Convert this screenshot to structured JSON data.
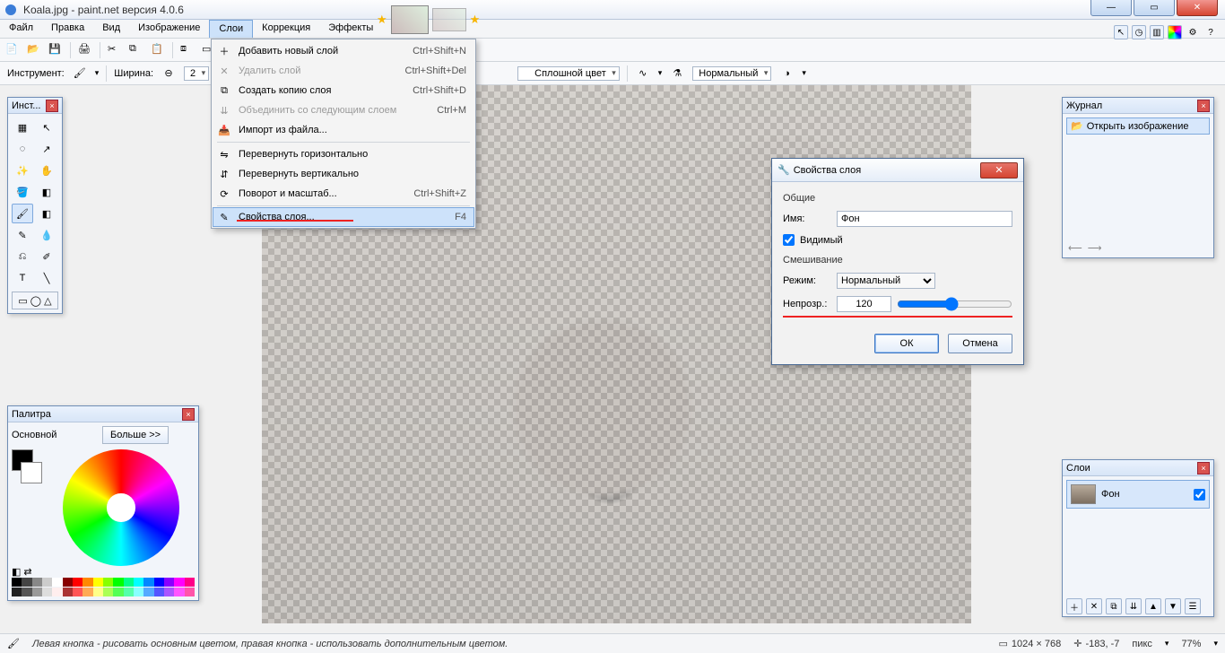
{
  "title": "Koala.jpg - paint.net версия 4.0.6",
  "menubar": [
    "Файл",
    "Правка",
    "Вид",
    "Изображение",
    "Слои",
    "Коррекция",
    "Эффекты"
  ],
  "menubar_active_index": 4,
  "layers_menu": {
    "items": [
      {
        "label": "Добавить новый слой",
        "sc": "Ctrl+Shift+N",
        "disabled": false
      },
      {
        "label": "Удалить слой",
        "sc": "Ctrl+Shift+Del",
        "disabled": true
      },
      {
        "label": "Создать копию слоя",
        "sc": "Ctrl+Shift+D",
        "disabled": false
      },
      {
        "label": "Объединить со следующим слоем",
        "sc": "Ctrl+M",
        "disabled": true
      },
      {
        "label": "Импорт из файла...",
        "sc": "",
        "disabled": false
      },
      {
        "sep": true
      },
      {
        "label": "Перевернуть горизонтально",
        "sc": "",
        "disabled": false
      },
      {
        "label": "Перевернуть вертикально",
        "sc": "",
        "disabled": false
      },
      {
        "label": "Поворот и масштаб...",
        "sc": "Ctrl+Shift+Z",
        "disabled": false
      },
      {
        "sep": true
      },
      {
        "label": "Свойства слоя...",
        "sc": "F4",
        "disabled": false,
        "hover": true,
        "underline": true
      }
    ]
  },
  "tool_row": {
    "instrument_label": "Инструмент:",
    "width_label": "Ширина:",
    "width_value": "2",
    "fill_label": "Сплошной цвет",
    "blend_label": "Нормальный"
  },
  "tools_panel_title": "Инст...",
  "palette": {
    "title": "Палитра",
    "primary": "Основной",
    "more": "Больше >>"
  },
  "history": {
    "title": "Журнал",
    "item": "Открыть изображение"
  },
  "layers_panel": {
    "title": "Слои",
    "layer_name": "Фон"
  },
  "layer_props": {
    "title": "Свойства слоя",
    "general": "Общие",
    "name_label": "Имя:",
    "name_value": "Фон",
    "visible": "Видимый",
    "blend_heading": "Смешивание",
    "mode_label": "Режим:",
    "mode_value": "Нормальный",
    "opacity_label": "Непрозр.:",
    "opacity_value": "120",
    "ok": "ОК",
    "cancel": "Отмена"
  },
  "status": {
    "hint": "Левая кнопка - рисовать основным цветом, правая кнопка - использовать дополнительным цветом.",
    "dims": "1024 × 768",
    "coords": "-183, -7",
    "units": "пикс",
    "zoom": "77%"
  }
}
